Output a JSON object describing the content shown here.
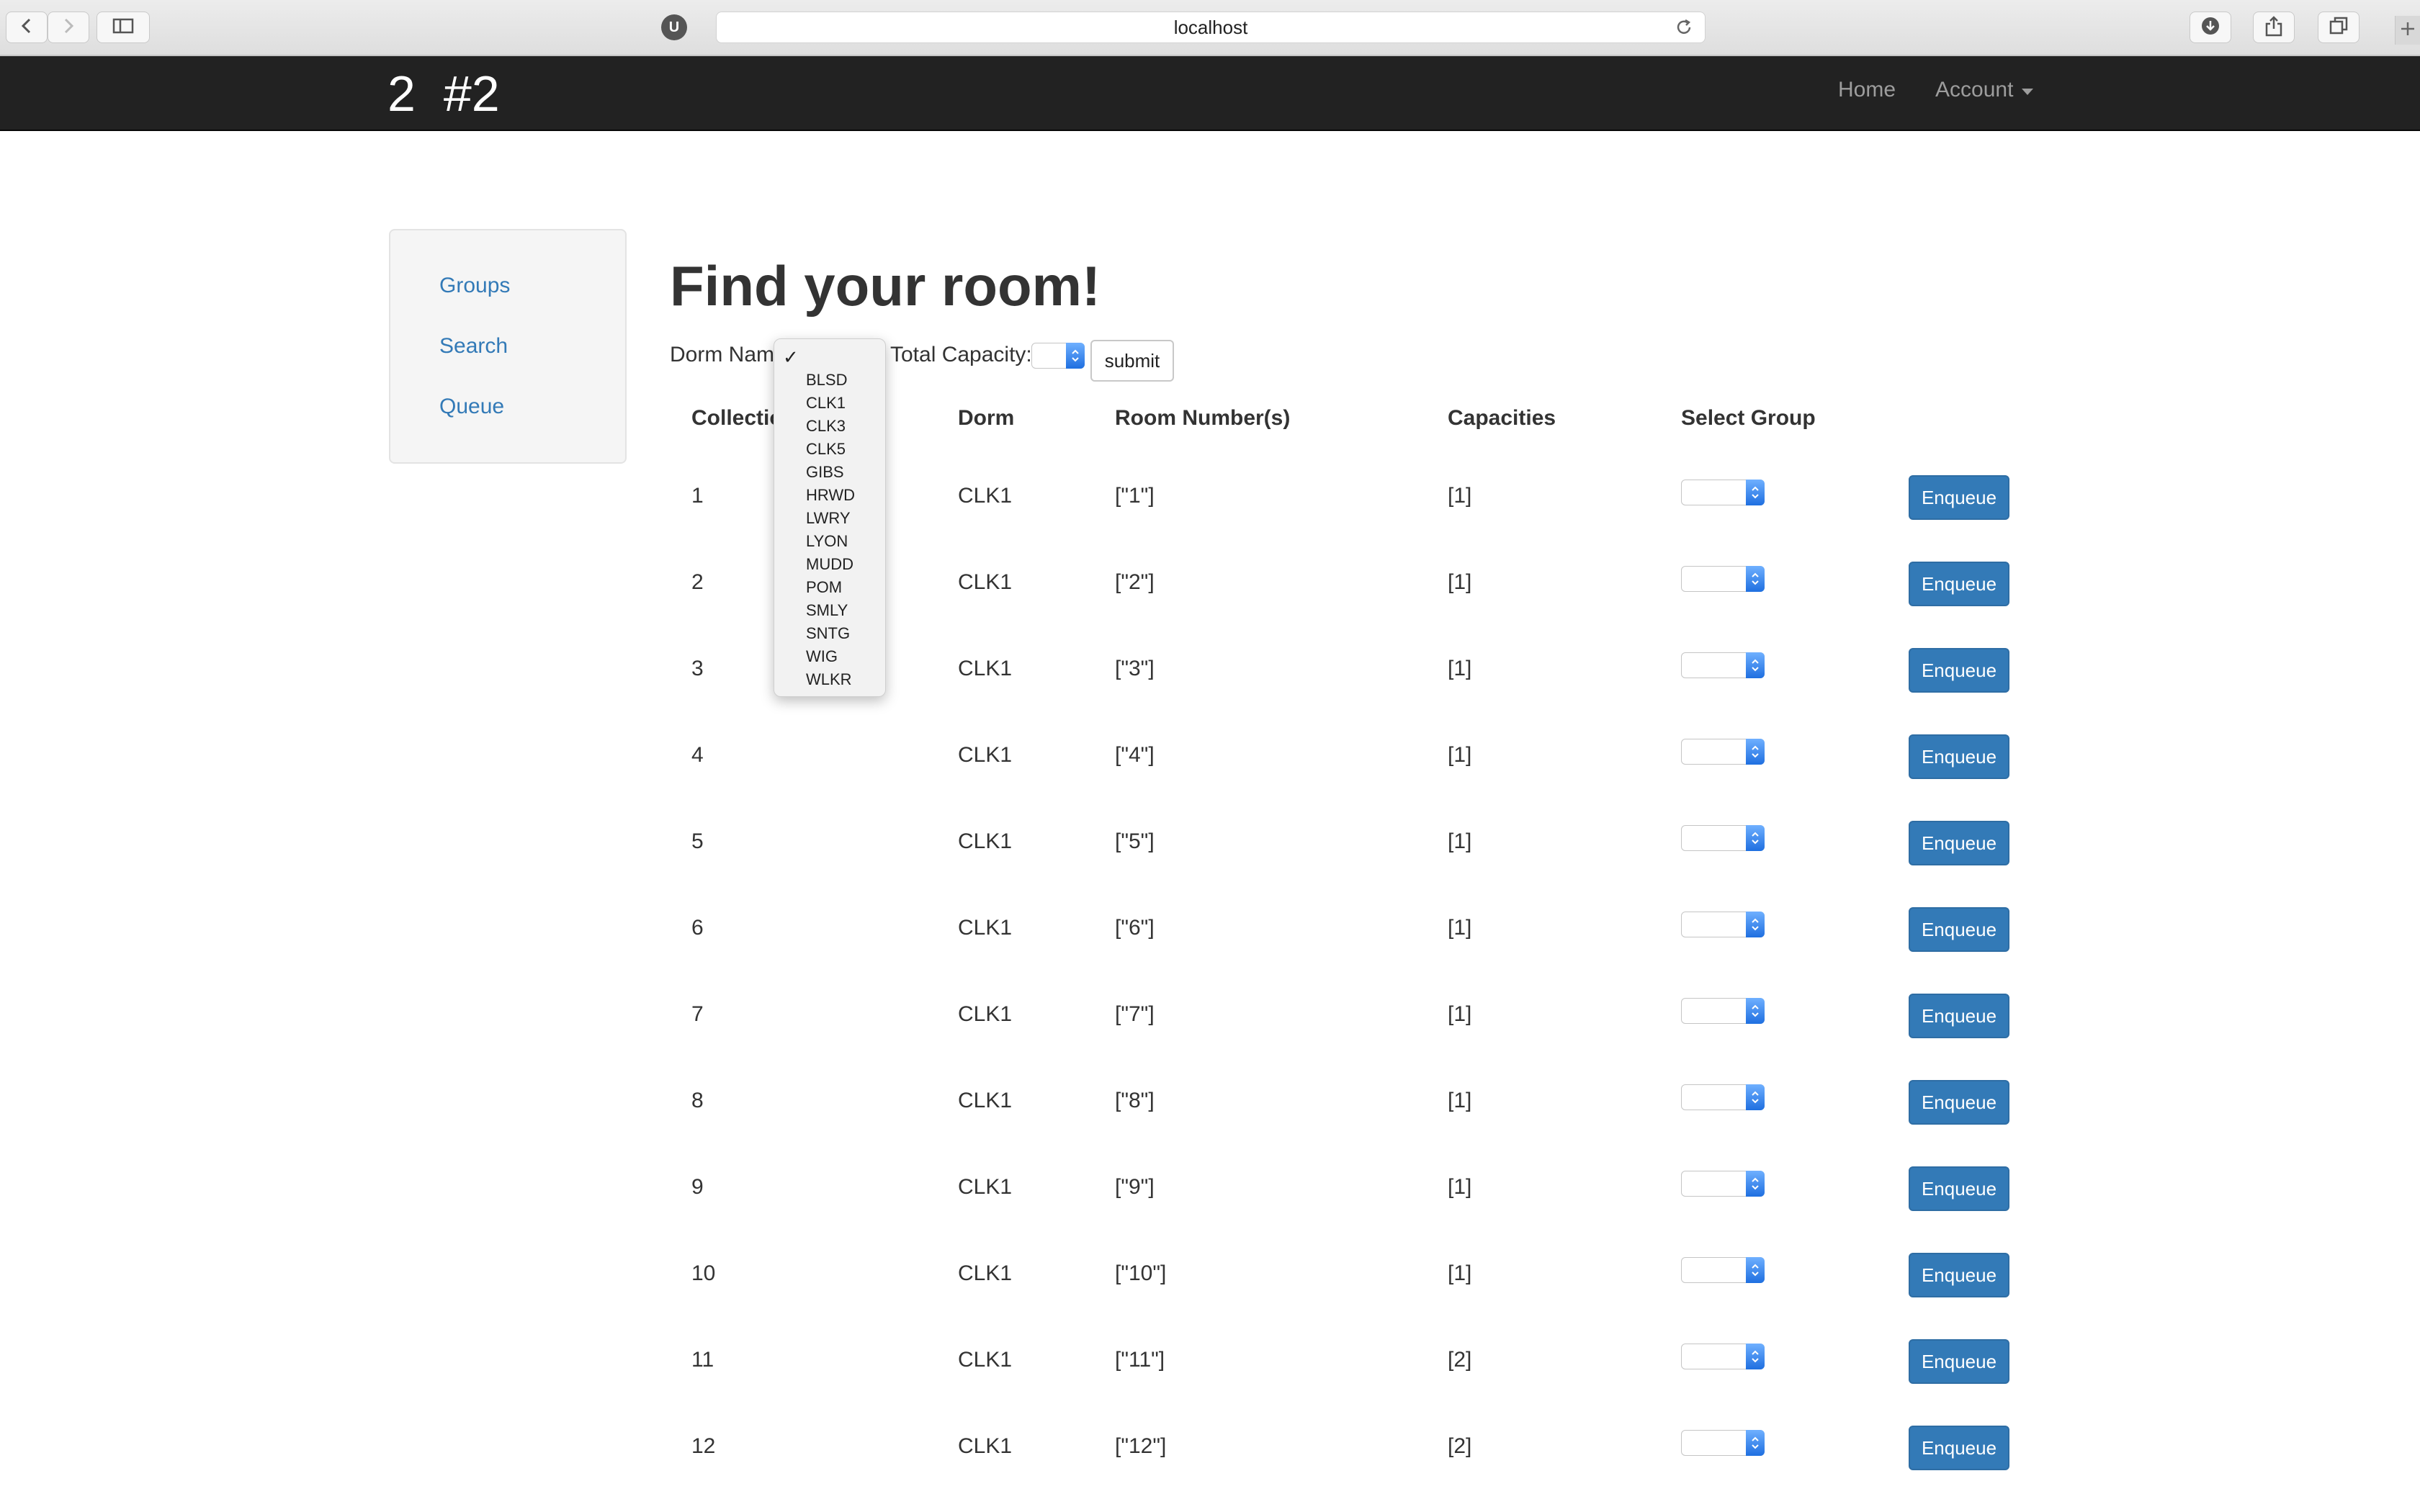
{
  "browser": {
    "url": "localhost",
    "extension_letter": "U"
  },
  "navbar": {
    "brand": "2  #2",
    "home": "Home",
    "account": "Account"
  },
  "sidebar": {
    "items": [
      {
        "label": "Groups"
      },
      {
        "label": "Search"
      },
      {
        "label": "Queue"
      }
    ]
  },
  "main": {
    "title": "Find your room!",
    "dorm_label": "Dorm Name",
    "capacity_label": "Total Capacity:",
    "submit_label": "submit"
  },
  "dropdown": {
    "selected_mark": "✓",
    "options": [
      "BLSD",
      "CLK1",
      "CLK3",
      "CLK5",
      "GIBS",
      "HRWD",
      "LWRY",
      "LYON",
      "MUDD",
      "POM",
      "SMLY",
      "SNTG",
      "WIG",
      "WLKR"
    ]
  },
  "table": {
    "headers": [
      "Collection",
      "Dorm",
      "Room Number(s)",
      "Capacities",
      "Select Group"
    ],
    "enqueue_label": "Enqueue",
    "rows": [
      {
        "collection": "1",
        "dorm": "CLK1",
        "rooms": "[\"1\"]",
        "capacities": "[1]"
      },
      {
        "collection": "2",
        "dorm": "CLK1",
        "rooms": "[\"2\"]",
        "capacities": "[1]"
      },
      {
        "collection": "3",
        "dorm": "CLK1",
        "rooms": "[\"3\"]",
        "capacities": "[1]"
      },
      {
        "collection": "4",
        "dorm": "CLK1",
        "rooms": "[\"4\"]",
        "capacities": "[1]"
      },
      {
        "collection": "5",
        "dorm": "CLK1",
        "rooms": "[\"5\"]",
        "capacities": "[1]"
      },
      {
        "collection": "6",
        "dorm": "CLK1",
        "rooms": "[\"6\"]",
        "capacities": "[1]"
      },
      {
        "collection": "7",
        "dorm": "CLK1",
        "rooms": "[\"7\"]",
        "capacities": "[1]"
      },
      {
        "collection": "8",
        "dorm": "CLK1",
        "rooms": "[\"8\"]",
        "capacities": "[1]"
      },
      {
        "collection": "9",
        "dorm": "CLK1",
        "rooms": "[\"9\"]",
        "capacities": "[1]"
      },
      {
        "collection": "10",
        "dorm": "CLK1",
        "rooms": "[\"10\"]",
        "capacities": "[1]"
      },
      {
        "collection": "11",
        "dorm": "CLK1",
        "rooms": "[\"11\"]",
        "capacities": "[2]"
      },
      {
        "collection": "12",
        "dorm": "CLK1",
        "rooms": "[\"12\"]",
        "capacities": "[2]"
      }
    ]
  }
}
